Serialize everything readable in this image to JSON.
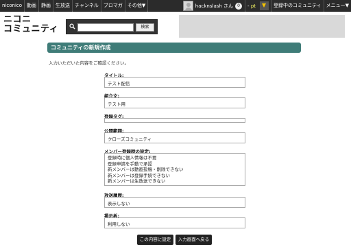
{
  "nav": {
    "items": [
      "niconico",
      "動画",
      "静画",
      "生放送",
      "チャンネル",
      "ブロマガ",
      "その他▼"
    ],
    "user_name": "hacknslash さん",
    "premium_badge": "0",
    "points_prefix": "-",
    "points_unit": "pt",
    "community_link": "登録中のコミュニティ",
    "menu_link": "メニュー▼"
  },
  "header": {
    "logo_line1": "ニコニ",
    "logo_line2": "コミュニティ",
    "search_button": "検索",
    "search_value": ""
  },
  "page": {
    "title": "コミュニティの新規作成",
    "intro": "入力いただいた内容をご確認ください。"
  },
  "form": {
    "title_label": "タイトル:",
    "title_value": "テスト配信",
    "intro_label": "紹介文:",
    "intro_value": "テスト用",
    "tag_label": "登録タグ:",
    "tag_value": "",
    "visibility_label": "公開範囲:",
    "visibility_value": "クローズコミュニティ",
    "member_label": "メンバー登録時の設定:",
    "member_lines": [
      "登録時に個人情報は不要",
      "登録申請を手動で承認",
      "新メンバーは動画投稿・削除できない",
      "新メンバーは登録手続できない",
      "新メンバーは生放送できない"
    ],
    "history_label": "放送履歴:",
    "history_value": "表示しない",
    "board_label": "掲示板:",
    "board_value": "利用しない"
  },
  "buttons": {
    "confirm": "この内容に設定",
    "back": "入力画面へ戻る"
  }
}
